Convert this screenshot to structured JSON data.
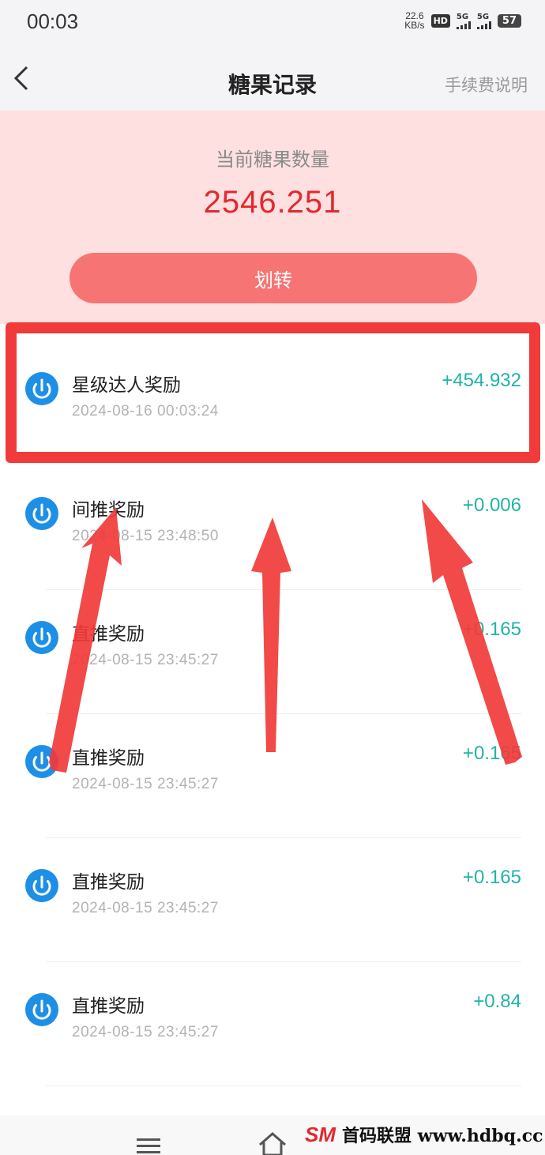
{
  "status_bar": {
    "time": "00:03",
    "net_speed_value": "22.6",
    "net_speed_unit": "KB/s",
    "hd_label": "HD",
    "signal_1": "5G",
    "signal_2": "5G",
    "battery": "57"
  },
  "nav": {
    "back_icon": "chevron-left-icon",
    "title": "糖果记录",
    "fee_link": "手续费说明"
  },
  "summary": {
    "label": "当前糖果数量",
    "value": "2546.251",
    "transfer_button": "划转"
  },
  "records": [
    {
      "title": "星级达人奖励",
      "time": "2024-08-16 00:03:24",
      "amount": "+454.932",
      "icon": "upload-circle-icon"
    },
    {
      "title": "间推奖励",
      "time": "2024-08-15 23:48:50",
      "amount": "+0.006",
      "icon": "upload-circle-icon"
    },
    {
      "title": "直推奖励",
      "time": "2024-08-15 23:45:27",
      "amount": "+0.165",
      "icon": "upload-circle-icon"
    },
    {
      "title": "直推奖励",
      "time": "2024-08-15 23:45:27",
      "amount": "+0.165",
      "icon": "upload-circle-icon"
    },
    {
      "title": "直推奖励",
      "time": "2024-08-15 23:45:27",
      "amount": "+0.165",
      "icon": "upload-circle-icon"
    },
    {
      "title": "直推奖励",
      "time": "2024-08-15 23:45:27",
      "amount": "+0.84",
      "icon": "upload-circle-icon"
    }
  ],
  "colors": {
    "accent_red": "#e3282f",
    "button_red": "#f67574",
    "hero_bg": "#fde0df",
    "amount_green": "#22b3a4",
    "icon_blue": "#1e8fe6",
    "annotation_red": "#f13a3a"
  },
  "bottom_bar": {
    "menu_icon": "menu-icon",
    "home_icon": "home-icon",
    "watermark_logo": "SM",
    "watermark_text": "首码联盟 www.hdbq.cc"
  }
}
